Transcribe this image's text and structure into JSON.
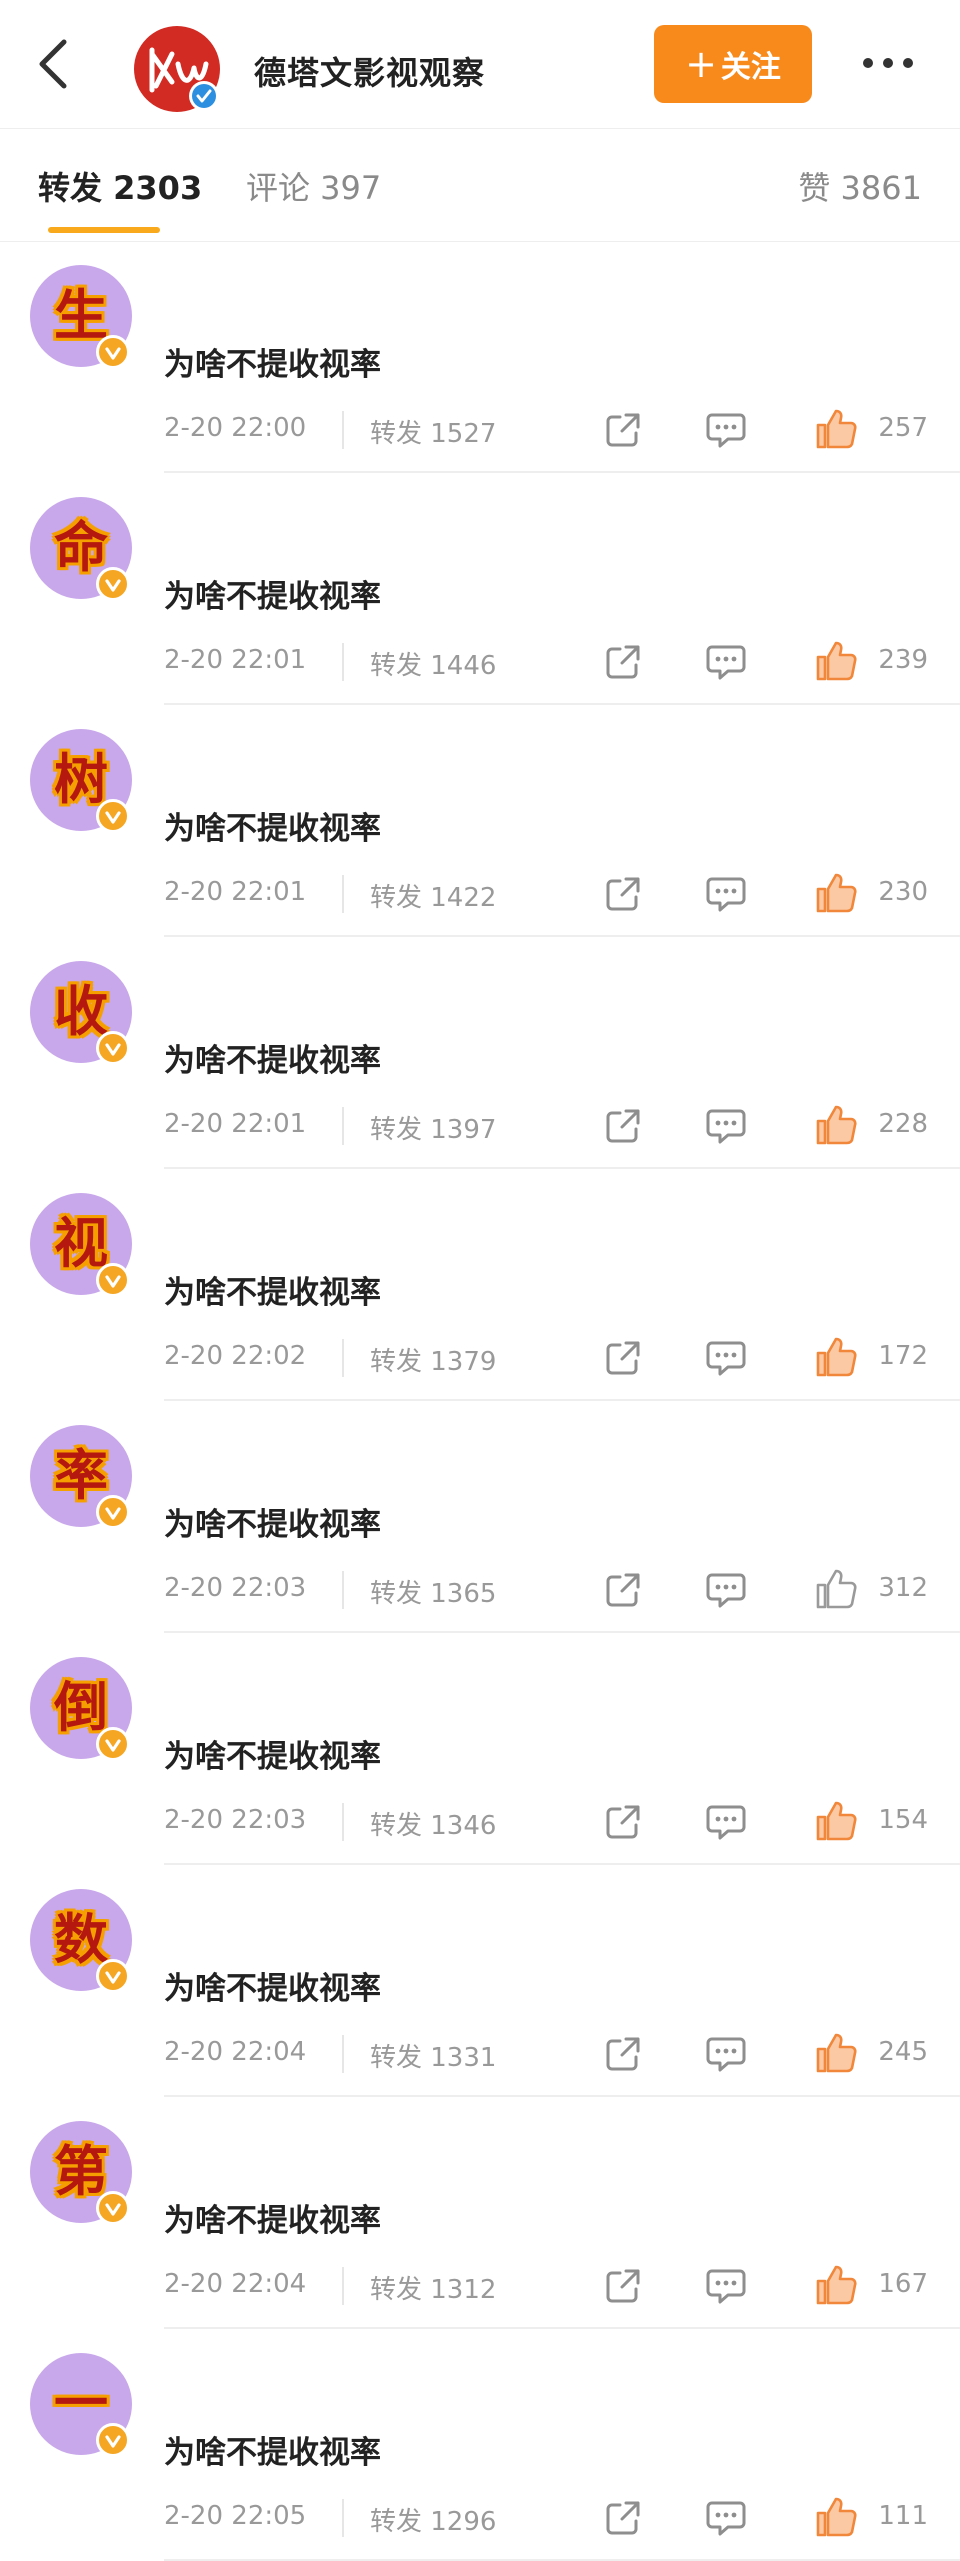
{
  "header": {
    "account_name": "德塔文影视观察",
    "follow_label": "关注",
    "follow_prefix": "+",
    "icons": [
      "back-icon",
      "account-avatar",
      "verified-badge-icon",
      "more-icon"
    ],
    "accent_color": "#f88a1c"
  },
  "tabs": {
    "repost": "转发 2303",
    "comment": "评论 397",
    "like": "赞 3861",
    "active": "repost",
    "active_color": "#f8a91c"
  },
  "reposts": [
    {
      "avatar_char": "生",
      "text": "为啥不提收视率",
      "time": "2-20 22:00",
      "reposts": "转发 1527",
      "likes": "257",
      "liked": true
    },
    {
      "avatar_char": "命",
      "text": "为啥不提收视率",
      "time": "2-20 22:01",
      "reposts": "转发 1446",
      "likes": "239",
      "liked": true
    },
    {
      "avatar_char": "树",
      "text": "为啥不提收视率",
      "time": "2-20 22:01",
      "reposts": "转发 1422",
      "likes": "230",
      "liked": true
    },
    {
      "avatar_char": "收",
      "text": "为啥不提收视率",
      "time": "2-20 22:01",
      "reposts": "转发 1397",
      "likes": "228",
      "liked": true
    },
    {
      "avatar_char": "视",
      "text": "为啥不提收视率",
      "time": "2-20 22:02",
      "reposts": "转发 1379",
      "likes": "172",
      "liked": true
    },
    {
      "avatar_char": "率",
      "text": "为啥不提收视率",
      "time": "2-20 22:03",
      "reposts": "转发 1365",
      "likes": "312",
      "liked": false
    },
    {
      "avatar_char": "倒",
      "text": "为啥不提收视率",
      "time": "2-20 22:03",
      "reposts": "转发 1346",
      "likes": "154",
      "liked": true
    },
    {
      "avatar_char": "数",
      "text": "为啥不提收视率",
      "time": "2-20 22:04",
      "reposts": "转发 1331",
      "likes": "245",
      "liked": true
    },
    {
      "avatar_char": "第",
      "text": "为啥不提收视率",
      "time": "2-20 22:04",
      "reposts": "转发 1312",
      "likes": "167",
      "liked": true
    },
    {
      "avatar_char": "一",
      "text": "为啥不提收视率",
      "time": "2-20 22:05",
      "reposts": "转发 1296",
      "likes": "111",
      "liked": true
    }
  ],
  "colors": {
    "avatar_bg": "#c8a8ea",
    "badge": "#f5a623",
    "like_active": "#f0873a",
    "like_inactive": "#9a9a9a",
    "meta_text": "#999999"
  }
}
